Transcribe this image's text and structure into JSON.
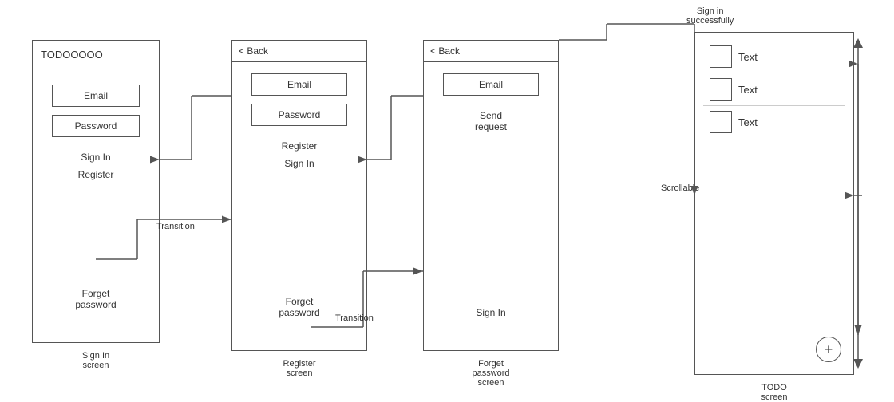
{
  "screens": {
    "signin": {
      "label_top": "TODOOOOO",
      "email_label": "Email",
      "password_label": "Password",
      "signin_label": "Sign In",
      "register_label": "Register",
      "forget_label": "Forget\npassword",
      "screen_label": "Sign In\nscreen"
    },
    "register": {
      "back_label": "< Back",
      "email_label": "Email",
      "password_label": "Password",
      "register_label": "Register",
      "signin_label": "Sign In",
      "forget_label": "Forget\npassword",
      "screen_label": "Register\nscreen",
      "transition_label": "Transition"
    },
    "forget": {
      "back_label": "< Back",
      "email_label": "Email",
      "send_label": "Send\nrequest",
      "signin_label": "Sign In",
      "screen_label": "Forget\npassword\nscreen",
      "transition_label": "Transition"
    },
    "todo": {
      "screen_label": "TODO\nscreen",
      "scrollable_label": "Scrollable",
      "sign_in_successfully": "Sign in\nsuccessfully",
      "items": [
        {
          "text": "Text"
        },
        {
          "text": "Text"
        },
        {
          "text": "Text"
        }
      ],
      "plus_label": "+"
    }
  },
  "arrows": {
    "transition_register": "Transition",
    "transition_forget": "Transition"
  }
}
